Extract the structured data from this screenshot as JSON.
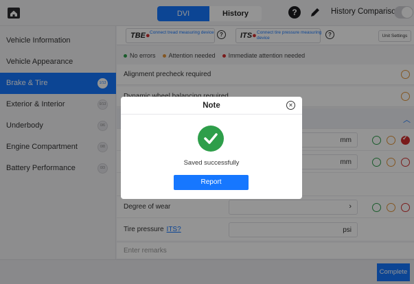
{
  "topbar": {
    "tabs": [
      {
        "label": "DVI"
      },
      {
        "label": "History"
      }
    ],
    "history_comparison_label": "History Comparison"
  },
  "sidebar": {
    "items": [
      {
        "label": "Vehicle Information",
        "badge": ""
      },
      {
        "label": "Vehicle Appearance",
        "badge": ""
      },
      {
        "label": "Brake & Tire",
        "badge": "1/13"
      },
      {
        "label": "Exterior & Interior",
        "badge": "0/13"
      },
      {
        "label": "Underbody",
        "badge": "0/6"
      },
      {
        "label": "Engine Compartment",
        "badge": "0/8"
      },
      {
        "label": "Battery Performance",
        "badge": "0/3"
      }
    ]
  },
  "main": {
    "tbe_logo": "TBE",
    "tbe_text": "Connect tread measuring device",
    "its_logo": "ITS",
    "its_text": "Connect tire pressure measuring device",
    "unit_settings": "Unit Settings",
    "legend": [
      {
        "label": "No errors",
        "color": "#2e9e4a"
      },
      {
        "label": "Attention needed",
        "color": "#e2953a"
      },
      {
        "label": "Immediate attention needed",
        "color": "#d32f2f"
      }
    ],
    "rows": {
      "alignment": "Alignment precheck required",
      "balancing": "Dynamic wheel balancing required",
      "mm_unit": "mm",
      "degree_of_wear": "Degree of wear",
      "tire_pressure": "Tire pressure",
      "tire_pressure_link": "ITS?",
      "psi_unit": "psi",
      "remarks_placeholder": "Enter remarks"
    }
  },
  "bottom": {
    "complete": "Complete"
  },
  "modal": {
    "title": "Note",
    "message": "Saved successfully",
    "button": "Report"
  },
  "colors": {
    "accent": "#1677ff",
    "success": "#2e9e4a",
    "warning": "#e2953a",
    "danger": "#d32f2f"
  }
}
